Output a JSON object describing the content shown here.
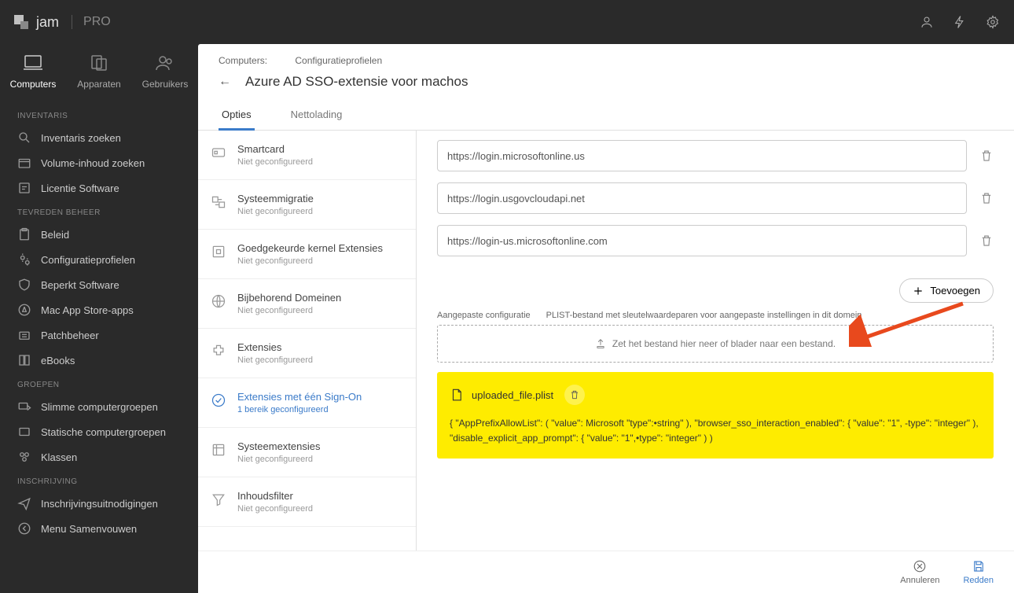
{
  "brand": {
    "name": "jam",
    "tier": "PRO"
  },
  "topnav": {
    "tabs": [
      {
        "label": "Computers"
      },
      {
        "label": "Apparaten"
      },
      {
        "label": "Gebruikers"
      }
    ]
  },
  "sidebar": {
    "sections": [
      {
        "header": "INVENTARIS",
        "items": [
          {
            "label": "Inventaris zoeken"
          },
          {
            "label": "Volume-inhoud zoeken"
          },
          {
            "label": "Licentie   Software"
          }
        ]
      },
      {
        "header": "TEVREDEN   BEHEER",
        "items": [
          {
            "label": "Beleid"
          },
          {
            "label": "Configuratieprofielen"
          },
          {
            "label": "Beperkt     Software"
          },
          {
            "label": "Mac App Store-apps"
          },
          {
            "label": "Patchbeheer"
          },
          {
            "label": "eBooks"
          }
        ]
      },
      {
        "header": "GROEPEN",
        "items": [
          {
            "label": "Slimme computergroepen"
          },
          {
            "label": "Statische computergroepen"
          },
          {
            "label": "Klassen"
          }
        ]
      },
      {
        "header": "INSCHRIJVING",
        "items": [
          {
            "label": "Inschrijvingsuitnodigingen"
          },
          {
            "label": "Menu Samenvouwen"
          }
        ]
      }
    ]
  },
  "breadcrumb": {
    "a": "Computers:",
    "b": "Configuratieprofielen"
  },
  "page_title": "Azure AD SSO-extensie voor machos",
  "tabs": [
    {
      "label": "Opties"
    },
    {
      "label": "Nettolading"
    }
  ],
  "options": [
    {
      "title": "Smartcard",
      "sub": "Niet geconfigureerd"
    },
    {
      "title": "Systeemmigratie",
      "sub": "Niet geconfigureerd"
    },
    {
      "title": "Goedgekeurde kernel  Extensies",
      "sub": "Niet geconfigureerd"
    },
    {
      "title": "Bijbehorend   Domeinen",
      "sub": "Niet geconfigureerd"
    },
    {
      "title": "Extensies",
      "sub": "Niet geconfigureerd"
    },
    {
      "title": "Extensies met één Sign-On",
      "sub": "1 bereik geconfigureerd"
    },
    {
      "title": "Systeemextensies",
      "sub": "Niet geconfigureerd"
    },
    {
      "title": "Inhoudsfilter",
      "sub": "Niet geconfigureerd"
    }
  ],
  "urls": [
    {
      "value": "https://login.microsoftonline.us"
    },
    {
      "value": "https://login.usgovcloudapi.net"
    },
    {
      "value": "https://login-us.microsoftonline.com"
    }
  ],
  "add_label": "Toevoegen",
  "custom_config_label_a": "Aangepaste configuratie",
  "custom_config_label_b": "PLIST-bestand met sleutelwaardeparen voor aangepaste instellingen in dit domein",
  "dropzone_text": "Zet het bestand hier neer of blader naar een bestand.",
  "uploaded_file": "uploaded_file.plist",
  "plist_text": "{ \"AppPrefixAllowList\": ( \"value\": Microsoft \"type\":•string\" ), \"browser_sso_interaction_enabled\": { \"value\": \"1\", -type\": \"integer\" ), \"disable_explicit_app_prompt\": { \"value\": \"1\",•type\": \"integer\" ) )",
  "footer": {
    "cancel": "Annuleren",
    "save": "Redden"
  }
}
